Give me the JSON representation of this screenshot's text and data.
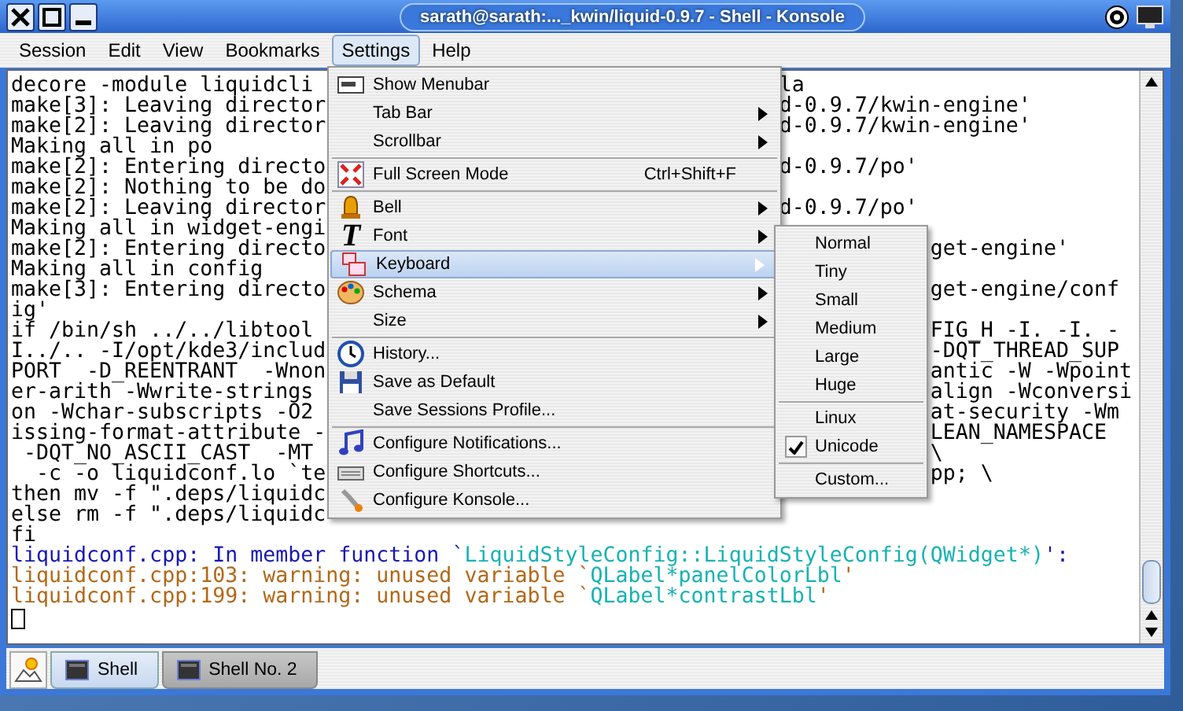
{
  "window": {
    "title": "sarath@sarath:..._kwin/liquid-0.9.7 - Shell - Konsole"
  },
  "menubar": {
    "items": [
      {
        "label": "Session",
        "selected": false
      },
      {
        "label": "Edit",
        "selected": false
      },
      {
        "label": "View",
        "selected": false
      },
      {
        "label": "Bookmarks",
        "selected": false
      },
      {
        "label": "Settings",
        "selected": true
      },
      {
        "label": "Help",
        "selected": false
      }
    ]
  },
  "terminal": {
    "lines": [
      {
        "kind": "menu",
        "left": "decore -module liquidcli",
        "right": "la"
      },
      {
        "kind": "menu",
        "left": "make[3]: Leaving director",
        "right": "d-0.9.7/kwin-engine'"
      },
      {
        "kind": "menu",
        "left": "make[2]: Leaving director",
        "right": "d-0.9.7/kwin-engine'"
      },
      {
        "kind": "plain",
        "text": "Making all in po"
      },
      {
        "kind": "menu",
        "left": "make[2]: Entering directo",
        "right": "d-0.9.7/po'"
      },
      {
        "kind": "menu",
        "left": "make[2]: Nothing to be do"
      },
      {
        "kind": "menu",
        "left": "make[2]: Leaving director",
        "right": "d-0.9.7/po'"
      },
      {
        "kind": "submenu",
        "left": "Making all in widget-engi"
      },
      {
        "kind": "submenu",
        "left": "make[2]: Entering directo",
        "right": "get-engine'"
      },
      {
        "kind": "plain",
        "text": "Making all in config"
      },
      {
        "kind": "submenu",
        "left": "make[3]: Entering directo",
        "right": "get-engine/conf"
      },
      {
        "kind": "plain",
        "text": "ig'"
      },
      {
        "kind": "submenu",
        "left": "if /bin/sh ../../libtool ",
        "right": "FIG_H -I. -I. -"
      },
      {
        "kind": "submenu",
        "left": "I../.. -I/opt/kde3/includ",
        "right": "-DQT_THREAD_SUP"
      },
      {
        "kind": "submenu",
        "left": "PORT  -D_REENTRANT  -Wnon",
        "right": "antic -W -Wpoint"
      },
      {
        "kind": "submenu",
        "left": "er-arith -Wwrite-strings ",
        "right": "align -Wconversi"
      },
      {
        "kind": "submenu",
        "left": "on -Wchar-subscripts -O2 ",
        "right": "at-security -Wm"
      },
      {
        "kind": "submenu",
        "left": "issing-format-attribute -",
        "right": "LEAN_NAMESPACE"
      },
      {
        "kind": "submenu",
        "left": " -DQT_NO_ASCII_CAST  -MT ",
        "right": "\\"
      },
      {
        "kind": "submenu",
        "left": "  -c -o liquidconf.lo `te",
        "right": "pp; \\"
      },
      {
        "kind": "menu",
        "left": "then mv -f \".deps/liquidc"
      },
      {
        "kind": "menu",
        "left": "else rm -f \".deps/liquidc"
      },
      {
        "kind": "plain",
        "text": "fi"
      },
      {
        "kind": "colored",
        "segments": [
          {
            "text": "liquidconf.cpp: In member function `",
            "color": "#1818b2"
          },
          {
            "text": "LiquidStyleConfig::LiquidStyleConfig(QWidget*)",
            "color": "#18b2b2"
          },
          {
            "text": "':",
            "color": "#1818b2"
          }
        ]
      },
      {
        "kind": "colored",
        "segments": [
          {
            "text": "liquidconf.cpp:103: warning: unused variable `",
            "color": "#b26818"
          },
          {
            "text": "QLabel*panelColorLbl",
            "color": "#18b2b2"
          },
          {
            "text": "'",
            "color": "#b26818"
          }
        ]
      },
      {
        "kind": "colored",
        "segments": [
          {
            "text": "liquidconf.cpp:199: warning: unused variable `",
            "color": "#b26818"
          },
          {
            "text": "QLabel*contrastLbl",
            "color": "#18b2b2"
          },
          {
            "text": "'",
            "color": "#b26818"
          }
        ]
      },
      {
        "kind": "cursor"
      }
    ]
  },
  "settings_menu": {
    "items": [
      {
        "kind": "menubar",
        "label": "Show Menubar",
        "submenu": false,
        "selected": false
      },
      {
        "kind": "plain",
        "label": "Tab Bar",
        "submenu": true,
        "selected": false
      },
      {
        "kind": "plain",
        "label": "Scrollbar",
        "submenu": true,
        "selected": false
      },
      {
        "kind": "separator"
      },
      {
        "kind": "fullscreen",
        "label": "Full Screen Mode",
        "shortcut": "Ctrl+Shift+F",
        "submenu": false,
        "selected": false
      },
      {
        "kind": "separator"
      },
      {
        "kind": "bell",
        "label": "Bell",
        "submenu": true,
        "selected": false
      },
      {
        "kind": "font",
        "icon_text": "T",
        "label": "Font",
        "submenu": true,
        "selected": false
      },
      {
        "kind": "keyboard",
        "label": "Keyboard",
        "submenu": true,
        "selected": true
      },
      {
        "kind": "palette",
        "label": "Schema",
        "submenu": true,
        "selected": false
      },
      {
        "kind": "plain",
        "label": "Size",
        "submenu": true,
        "selected": false
      },
      {
        "kind": "separator"
      },
      {
        "kind": "clock",
        "label": "History...",
        "submenu": false,
        "selected": false
      },
      {
        "kind": "floppy",
        "label": "Save as Default",
        "submenu": false,
        "selected": false
      },
      {
        "kind": "plain",
        "label": "Save Sessions Profile...",
        "submenu": false,
        "selected": false
      },
      {
        "kind": "separator"
      },
      {
        "kind": "note",
        "label": "Configure Notifications...",
        "submenu": false,
        "selected": false
      },
      {
        "kind": "keys",
        "label": "Configure Shortcuts...",
        "submenu": false,
        "selected": false
      },
      {
        "kind": "wrench",
        "label": "Configure Konsole...",
        "submenu": false,
        "selected": false
      }
    ]
  },
  "keyboard_submenu": {
    "items": [
      {
        "kind": "item",
        "label": "Normal",
        "checked": false
      },
      {
        "kind": "item",
        "label": "Tiny",
        "checked": false
      },
      {
        "kind": "item",
        "label": "Small",
        "checked": false
      },
      {
        "kind": "item",
        "label": "Medium",
        "checked": false
      },
      {
        "kind": "item",
        "label": "Large",
        "checked": false
      },
      {
        "kind": "item",
        "label": "Huge",
        "checked": false
      },
      {
        "kind": "separator"
      },
      {
        "kind": "item",
        "label": "Linux",
        "checked": false
      },
      {
        "kind": "item",
        "label": "Unicode",
        "checked": true
      },
      {
        "kind": "separator"
      },
      {
        "kind": "item",
        "label": "Custom...",
        "checked": false
      }
    ]
  },
  "tabs": [
    {
      "label": "Shell",
      "selected": true
    },
    {
      "label": "Shell No. 2",
      "selected": false
    }
  ]
}
